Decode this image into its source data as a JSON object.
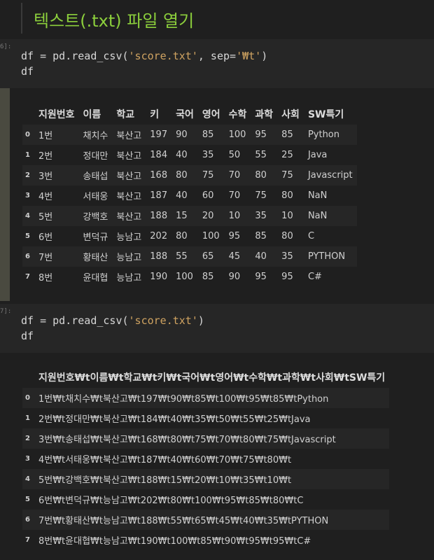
{
  "heading": {
    "title": "텍스트(.txt) 파일 열기"
  },
  "cell1": {
    "prompt": "6]:",
    "line1_pre": "df = pd.read_csv(",
    "line1_str1": "'score.txt'",
    "line1_mid": ", sep=",
    "line1_str2": "'₩t'",
    "line1_post": ")",
    "line2": "df"
  },
  "table1": {
    "columns": [
      "지원번호",
      "이름",
      "학교",
      "키",
      "국어",
      "영어",
      "수학",
      "과학",
      "사회",
      "SW특기"
    ],
    "rows": [
      {
        "index": "0",
        "cells": [
          "1번",
          "채치수",
          "북산고",
          "197",
          "90",
          "85",
          "100",
          "95",
          "85",
          "Python"
        ]
      },
      {
        "index": "1",
        "cells": [
          "2번",
          "정대만",
          "북산고",
          "184",
          "40",
          "35",
          "50",
          "55",
          "25",
          "Java"
        ]
      },
      {
        "index": "2",
        "cells": [
          "3번",
          "송태섭",
          "북산고",
          "168",
          "80",
          "75",
          "70",
          "80",
          "75",
          "Javascript"
        ]
      },
      {
        "index": "3",
        "cells": [
          "4번",
          "서태웅",
          "북산고",
          "187",
          "40",
          "60",
          "70",
          "75",
          "80",
          "NaN"
        ]
      },
      {
        "index": "4",
        "cells": [
          "5번",
          "강백호",
          "북산고",
          "188",
          "15",
          "20",
          "10",
          "35",
          "10",
          "NaN"
        ]
      },
      {
        "index": "5",
        "cells": [
          "6번",
          "변덕규",
          "능남고",
          "202",
          "80",
          "100",
          "95",
          "85",
          "80",
          "C"
        ]
      },
      {
        "index": "6",
        "cells": [
          "7번",
          "황태산",
          "능남고",
          "188",
          "55",
          "65",
          "45",
          "40",
          "35",
          "PYTHON"
        ]
      },
      {
        "index": "7",
        "cells": [
          "8번",
          "윤대협",
          "능남고",
          "190",
          "100",
          "85",
          "90",
          "95",
          "95",
          "C#"
        ]
      }
    ]
  },
  "cell2": {
    "prompt": "7]:",
    "line1_pre": "df = pd.read_csv(",
    "line1_str1": "'score.txt'",
    "line1_post": ")",
    "line2": "df"
  },
  "table2": {
    "column": "지원번호₩t이름₩t학교₩t키₩t국어₩t영어₩t수학₩t과학₩t사회₩tSW특기",
    "rows": [
      {
        "index": "0",
        "value": "1번₩t채치수₩t북산고₩t197₩t90₩t85₩t100₩t95₩t85₩tPython"
      },
      {
        "index": "1",
        "value": "2번₩t정대만₩t북산고₩t184₩t40₩t35₩t50₩t55₩t25₩tJava"
      },
      {
        "index": "2",
        "value": "3번₩t송태섭₩t북산고₩t168₩t80₩t75₩t70₩t80₩t75₩tJavascript"
      },
      {
        "index": "3",
        "value": "4번₩t서태웅₩t북산고₩t187₩t40₩t60₩t70₩t75₩t80₩t"
      },
      {
        "index": "4",
        "value": "5번₩t강백호₩t북산고₩t188₩t15₩t20₩t10₩t35₩t10₩t"
      },
      {
        "index": "5",
        "value": "6번₩t변덕규₩t능남고₩t202₩t80₩t100₩t95₩t85₩t80₩tC"
      },
      {
        "index": "6",
        "value": "7번₩t황태산₩t능남고₩t188₩t55₩t65₩t45₩t40₩t35₩tPYTHON"
      },
      {
        "index": "7",
        "value": "8번₩t윤대협₩t능남고₩t190₩t100₩t85₩t90₩t95₩t95₩tC#"
      }
    ]
  }
}
